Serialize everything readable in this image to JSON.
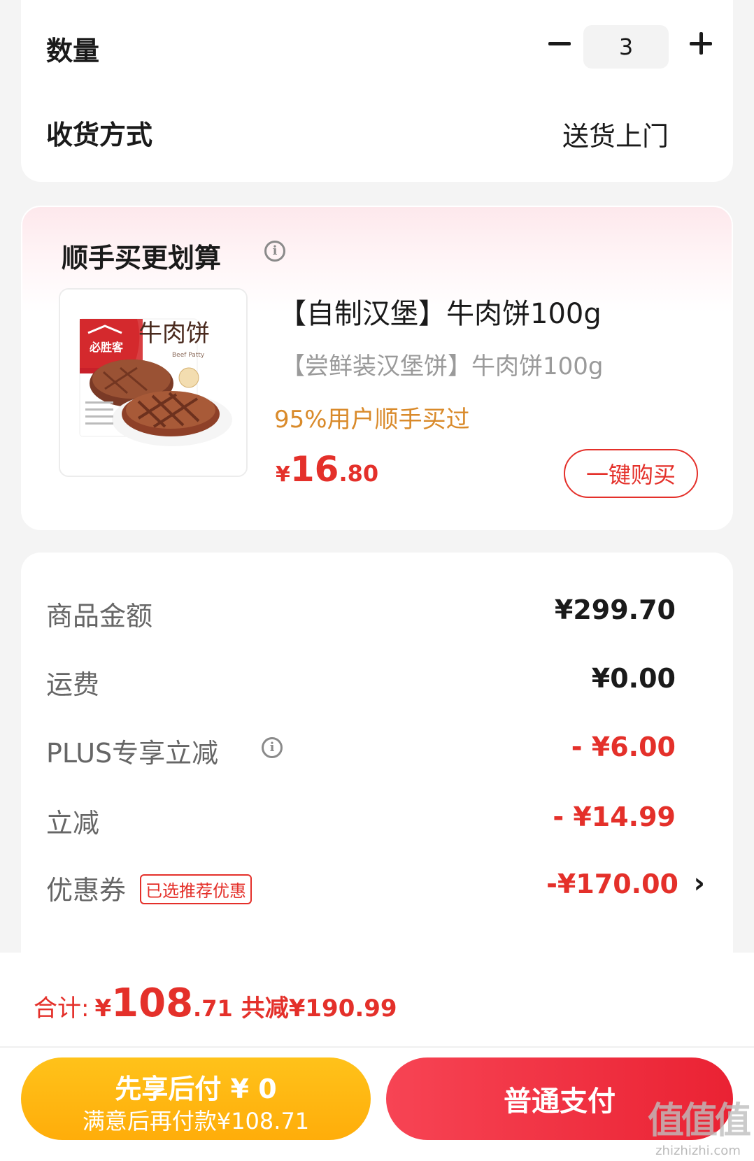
{
  "order": {
    "quantity_label": "数量",
    "quantity_value": "3",
    "delivery_label": "收货方式",
    "delivery_value": "送货上门"
  },
  "addon": {
    "title": "顺手买更划算",
    "info_icon": "info-circle-icon",
    "product": {
      "image_brand": "必胜客",
      "image_name": "牛肉饼",
      "image_caption": "Beef Patty",
      "title": "【自制汉堡】牛肉饼100g",
      "subtitle": "【尝鲜装汉堡饼】牛肉饼100g",
      "tag": "95%用户顺手买过",
      "price_symbol": "¥",
      "price_int": "16",
      "price_dec": ".80",
      "buy_label": "一键购买"
    }
  },
  "summary": {
    "goods_label": "商品金额",
    "goods_value": "¥299.70",
    "shipping_label": "运费",
    "shipping_value": "¥0.00",
    "plus_label": "PLUS专享立减",
    "plus_value": "- ¥6.00",
    "discount_label": "立减",
    "discount_value": "- ¥14.99",
    "coupon_label": "优惠券",
    "coupon_badge": "已选推荐优惠",
    "coupon_value": "-¥170.00",
    "coupon_arrow": "›"
  },
  "footer": {
    "total_label": "合计:",
    "total_symbol": "¥",
    "total_int": "108",
    "total_dec": ".71",
    "saved": "共减¥190.99",
    "later_pay_title": "先享后付 ¥ 0",
    "later_pay_sub": "满意后再付款¥108.71",
    "normal_pay_label": "普通支付",
    "watermark_logo": "值值值",
    "watermark_url": "zhizhizhi.com"
  },
  "colors": {
    "accent_red": "#e4302a",
    "tag_orange": "#d98a2a",
    "later_pay_yellow": "#ffb812",
    "normal_pay_red": "#f03443"
  }
}
